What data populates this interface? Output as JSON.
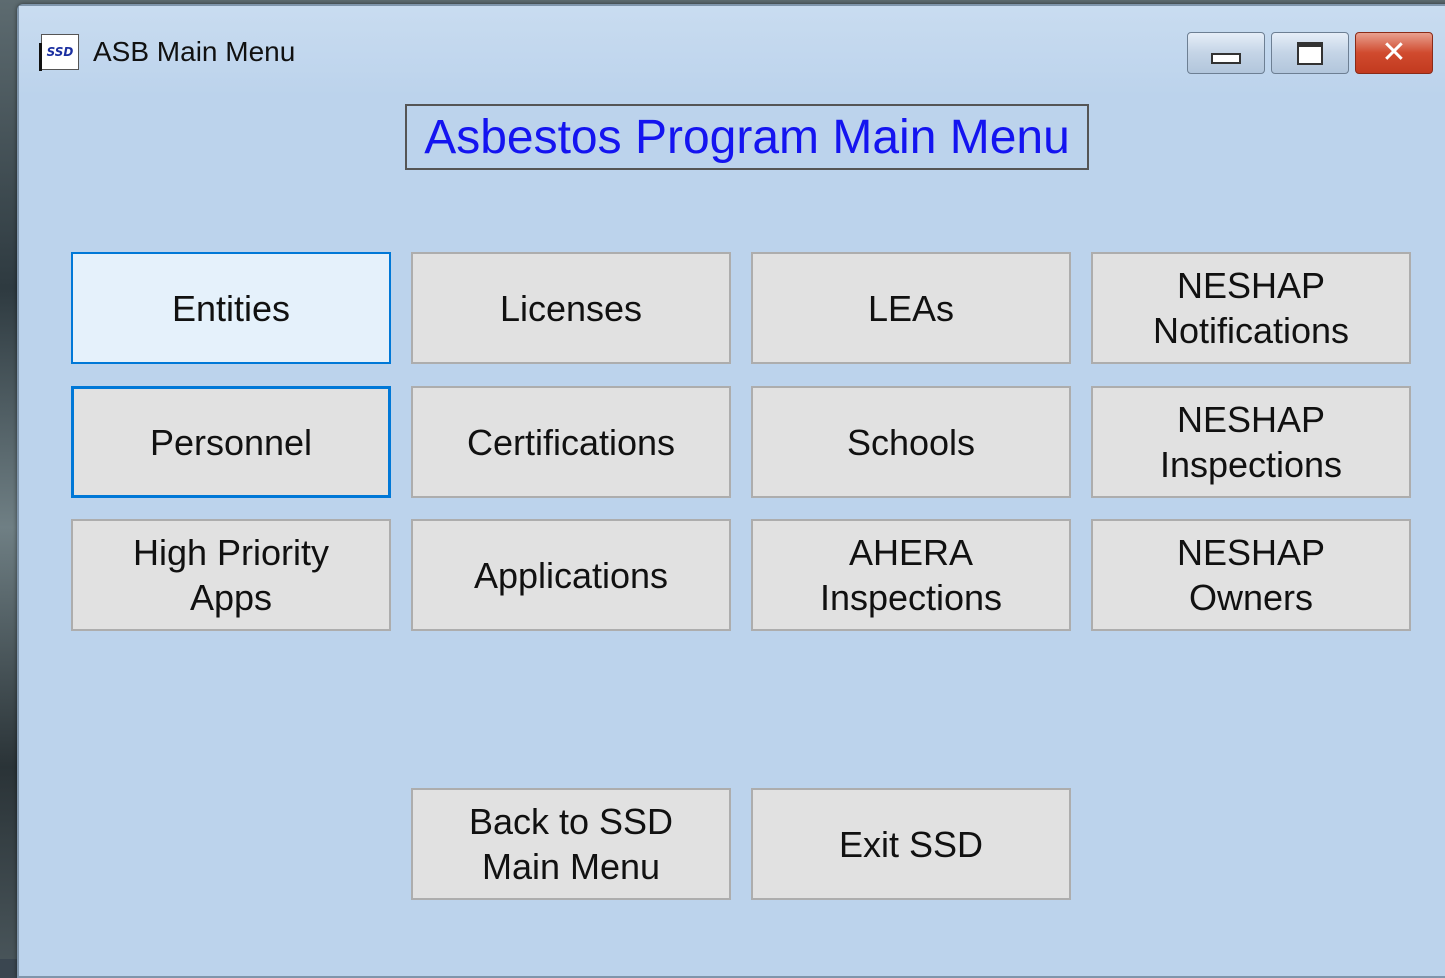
{
  "window": {
    "title": "ASB Main Menu",
    "icon_label": "SSD",
    "controls": {
      "minimize": "minimize-icon",
      "maximize": "maximize-icon",
      "close": "close-icon"
    }
  },
  "heading": "Asbestos Program Main Menu",
  "menu": {
    "entities": "Entities",
    "licenses": "Licenses",
    "leas": "LEAs",
    "neshap_notifications": "NESHAP\nNotifications",
    "personnel": "Personnel",
    "certifications": "Certifications",
    "schools": "Schools",
    "neshap_inspections": "NESHAP\nInspections",
    "high_priority_apps": "High Priority\nApps",
    "applications": "Applications",
    "ahera_inspections": "AHERA\nInspections",
    "neshap_owners": "NESHAP\nOwners"
  },
  "footer": {
    "back": "Back to SSD\nMain Menu",
    "exit": "Exit SSD"
  },
  "colors": {
    "window_bg": "#bcd3ec",
    "heading_text": "#1414f0",
    "button_bg": "#e1e1e1",
    "focus_border": "#0078d7"
  }
}
